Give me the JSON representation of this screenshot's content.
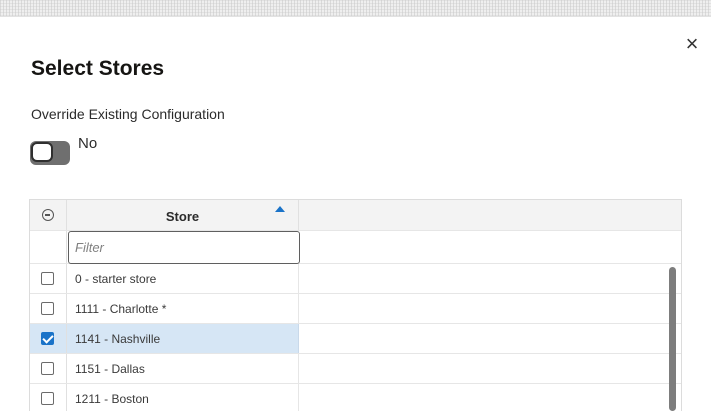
{
  "dialog": {
    "title": "Select Stores",
    "close_glyph": "×"
  },
  "override": {
    "label": "Override Existing Configuration",
    "toggle_state": "off",
    "toggle_value_text": "No"
  },
  "grid": {
    "columns": [
      {
        "key": "select",
        "label": ""
      },
      {
        "key": "store",
        "label": "Store",
        "sort": "ascending"
      }
    ],
    "filter": {
      "value": "",
      "placeholder": "Filter"
    },
    "rows": [
      {
        "store": "0 - starter store",
        "checked": false
      },
      {
        "store": "1111 - Charlotte *",
        "checked": false
      },
      {
        "store": "1141 - Nashville",
        "checked": true
      },
      {
        "store": "1151 - Dallas",
        "checked": false
      },
      {
        "store": "1211 - Boston",
        "checked": false
      }
    ]
  },
  "colors": {
    "accent": "#1a73c8",
    "selected_row": "#d6e6f5",
    "toggle_off": "#6f6f6f"
  },
  "icons": {
    "close": "close-icon",
    "select_all": "select-all-icon",
    "sort": "sort-ascending-icon"
  }
}
